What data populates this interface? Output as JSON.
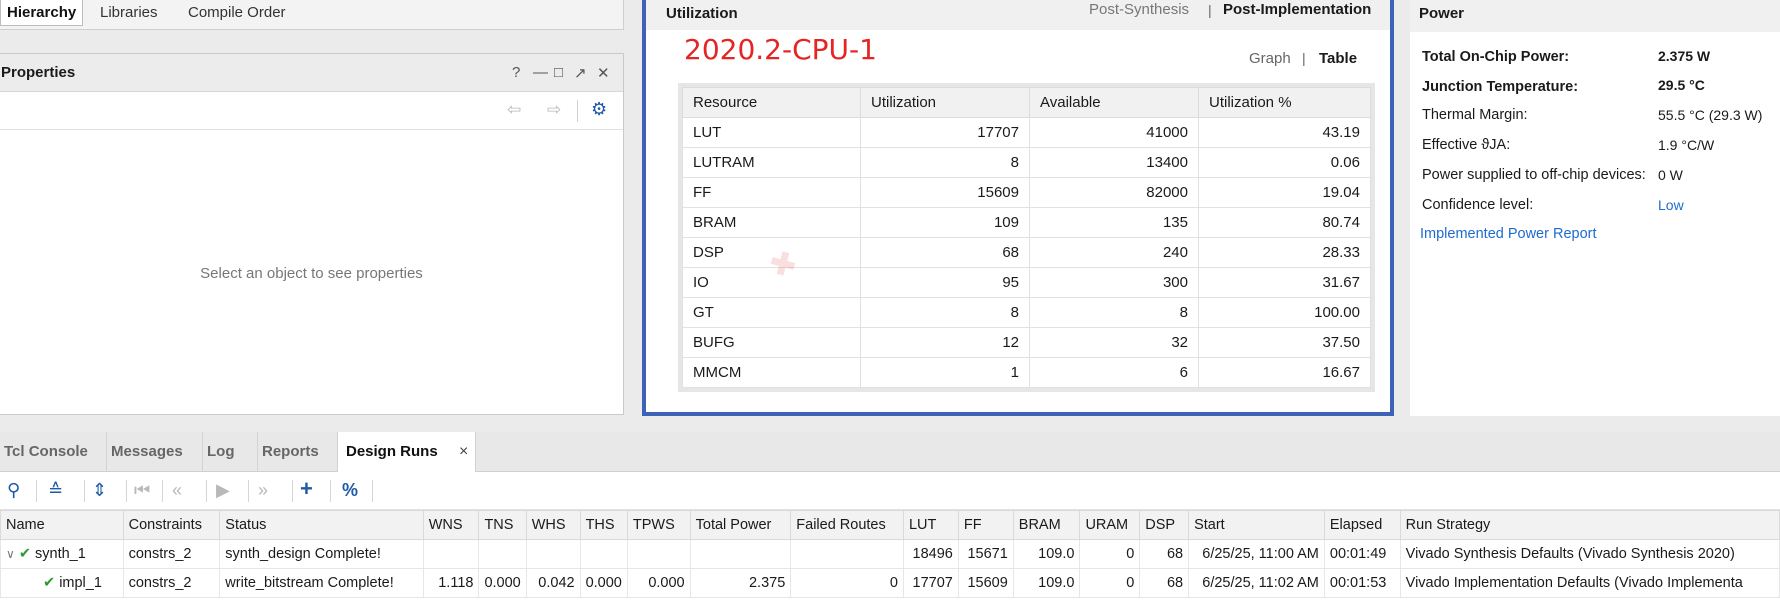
{
  "left_tabs": [
    "Hierarchy",
    "Libraries",
    "Compile Order"
  ],
  "properties": {
    "title": "Properties",
    "empty_text": "Select an object to see properties"
  },
  "utilization": {
    "title": "Utilization",
    "modes": [
      "Post-Synthesis",
      "Post-Implementation"
    ],
    "active_mode": "Post-Implementation",
    "version_label": "2020.2-CPU-1",
    "views": [
      "Graph",
      "Table"
    ],
    "active_view": "Table",
    "columns": [
      "Resource",
      "Utilization",
      "Available",
      "Utilization %"
    ],
    "rows": [
      [
        "LUT",
        "17707",
        "41000",
        "43.19"
      ],
      [
        "LUTRAM",
        "8",
        "13400",
        "0.06"
      ],
      [
        "FF",
        "15609",
        "82000",
        "19.04"
      ],
      [
        "BRAM",
        "109",
        "135",
        "80.74"
      ],
      [
        "DSP",
        "68",
        "240",
        "28.33"
      ],
      [
        "IO",
        "95",
        "300",
        "31.67"
      ],
      [
        "GT",
        "8",
        "8",
        "100.00"
      ],
      [
        "BUFG",
        "12",
        "32",
        "37.50"
      ],
      [
        "MMCM",
        "1",
        "6",
        "16.67"
      ]
    ]
  },
  "power": {
    "title": "Power",
    "rows": [
      {
        "label": "Total On-Chip Power:",
        "value": "2.375 W",
        "bold": true
      },
      {
        "label": "Junction Temperature:",
        "value": "29.5 °C",
        "bold": true
      },
      {
        "label": "Thermal Margin:",
        "value": "55.5 °C (29.3 W)",
        "bold": false
      },
      {
        "label": "Effective ϑJA:",
        "value": "1.9 °C/W",
        "bold": false
      },
      {
        "label": "Power supplied to off-chip devices:",
        "value": "0 W",
        "bold": false
      },
      {
        "label": "Confidence level:",
        "value": "Low",
        "bold": false
      }
    ],
    "report_link": "Implemented Power Report"
  },
  "bottom_tabs": [
    "Tcl Console",
    "Messages",
    "Log",
    "Reports",
    "Design Runs"
  ],
  "active_bottom_tab": "Design Runs",
  "runs": {
    "columns": [
      "Name",
      "Constraints",
      "Status",
      "WNS",
      "TNS",
      "WHS",
      "THS",
      "TPWS",
      "Total Power",
      "Failed Routes",
      "LUT",
      "FF",
      "BRAM",
      "URAM",
      "DSP",
      "Start",
      "Elapsed",
      "Run Strategy"
    ],
    "rows": [
      [
        "synth_1",
        "constrs_2",
        "synth_design Complete!",
        "",
        "",
        "",
        "",
        "",
        "",
        "",
        "18496",
        "15671",
        "109.0",
        "0",
        "68",
        "6/25/25, 11:00 AM",
        "00:01:49",
        "Vivado Synthesis Defaults (Vivado Synthesis 2020)"
      ],
      [
        "impl_1",
        "constrs_2",
        "write_bitstream Complete!",
        "1.118",
        "0.000",
        "0.042",
        "0.000",
        "0.000",
        "2.375",
        "0",
        "17707",
        "15609",
        "109.0",
        "0",
        "68",
        "6/25/25, 11:02 AM",
        "00:01:53",
        "Vivado Implementation Defaults (Vivado Implementa"
      ]
    ]
  },
  "colors": {
    "accent_blue": "#3d63b6",
    "link_blue": "#1e6bd0",
    "version_red": "#e52424",
    "check_green": "#2f9a2f"
  }
}
